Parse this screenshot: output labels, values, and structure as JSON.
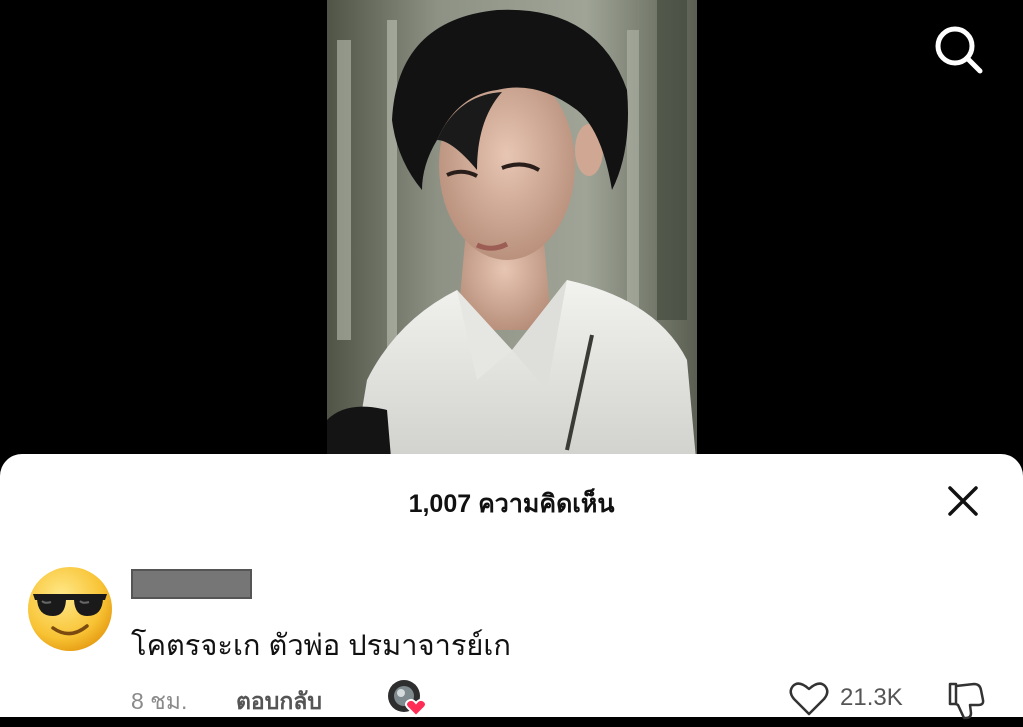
{
  "video": {
    "thumbnail_icon": "portrait-photo"
  },
  "comments_sheet": {
    "title": "1,007 ความคิดเห็น",
    "close_icon": "close-icon"
  },
  "comment": {
    "avatar_icon": "sunglasses-emoji-icon",
    "username": "",
    "text": "โคตรจะเก ตัวพ่อ ปรมาจารย์เก",
    "time": "8 ชม.",
    "reply_label": "ตอบกลับ",
    "like_count": "21.3K"
  },
  "colors": {
    "sheet_bg": "#ffffff",
    "text": "#111111",
    "muted": "#8a8a8a",
    "heart_badge": "#ff2d55"
  }
}
